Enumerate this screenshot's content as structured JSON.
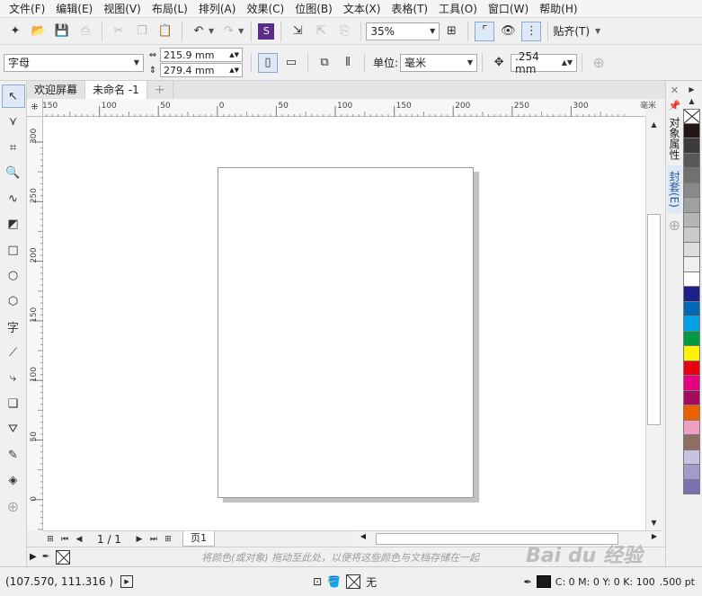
{
  "menubar": {
    "items": [
      "文件(F)",
      "编辑(E)",
      "视图(V)",
      "布局(L)",
      "排列(A)",
      "效果(C)",
      "位图(B)",
      "文本(X)",
      "表格(T)",
      "工具(O)",
      "窗口(W)",
      "帮助(H)"
    ]
  },
  "std_toolbar": {
    "zoom": "35%",
    "snap_label": "贴齐(T)"
  },
  "prop_toolbar": {
    "font_preset": "字母",
    "width": "215.9 mm",
    "height": "279.4 mm",
    "unit_label": "单位:",
    "unit": "毫米",
    "nudge": ".254 mm"
  },
  "tabs": [
    "欢迎屏幕",
    "未命名 -1"
  ],
  "ruler": {
    "h_ticks": [
      "150",
      "100",
      "50",
      "0",
      "50",
      "100",
      "150",
      "200",
      "250",
      "300"
    ],
    "v_ticks": [
      "300",
      "250",
      "200",
      "150",
      "100",
      "50",
      "0"
    ],
    "unit": "毫米"
  },
  "pagenav": {
    "count": "1 / 1",
    "page_tab": "页1"
  },
  "swatch_hint": "将颜色(或对象) 拖动至此处，以便将这些颜色与文档存储在一起",
  "status": {
    "coords": "(107.570, 111.316 )",
    "fill_label": "无",
    "outline_color": "C: 0 M: 0 Y: 0 K: 100",
    "outline_width": ".500 pt"
  },
  "dock": {
    "tab_object_props": "对象属性",
    "tab_envelope": "封套(E)"
  },
  "palette": {
    "colors": [
      "#231815",
      "#3e3a39",
      "#595757",
      "#727171",
      "#898989",
      "#9fa0a0",
      "#b5b5b6",
      "#c9caca",
      "#dcdddd",
      "#efefef",
      "#ffffff",
      "#1d2088",
      "#0068b7",
      "#00a0e9",
      "#009944",
      "#fff100",
      "#e60012",
      "#e4007f",
      "#a40b5d",
      "#eb6100",
      "#f19ec2",
      "#8c6e63",
      "#c9c3e0",
      "#a39bc9",
      "#7d71b0"
    ]
  },
  "watermark": "Bai du 经验"
}
